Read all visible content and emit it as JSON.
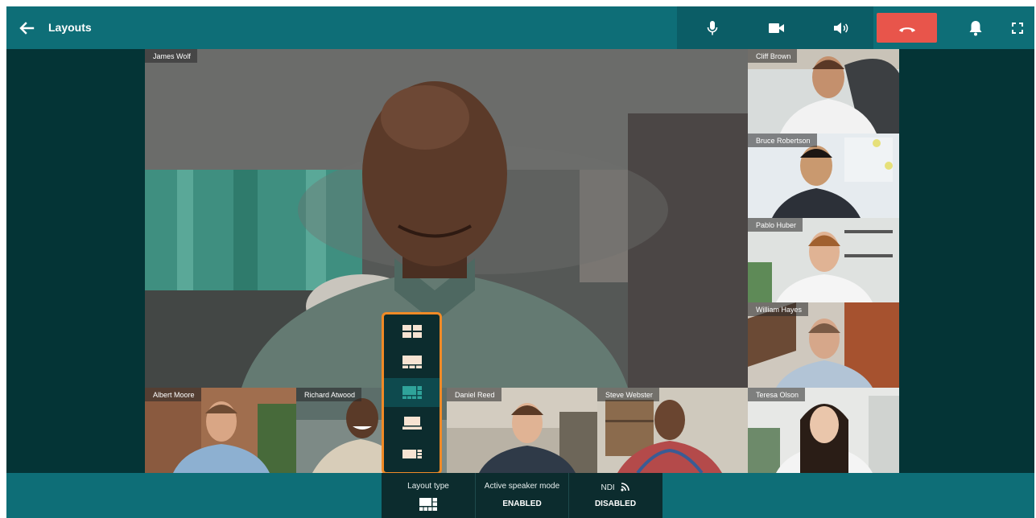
{
  "header": {
    "title": "Layouts",
    "icons": [
      "back-arrow-icon",
      "microphone-icon",
      "camera-icon",
      "speaker-icon",
      "hang-up-icon",
      "bell-icon",
      "fullscreen-icon"
    ]
  },
  "participants": {
    "main": "James Wolf",
    "side": [
      "Cliff Brown",
      "Bruce Robertson",
      "Pablo Huber",
      "William Hayes"
    ],
    "bottom": [
      "Albert Moore",
      "Richard Atwood",
      "Daniel Reed",
      "Steve Webster",
      "Teresa Olson"
    ]
  },
  "layout_picker": {
    "options": [
      "grid-layout-icon",
      "speaker-top-layout-icon",
      "mosaic-layout-icon",
      "speaker-bottom-layout-icon",
      "speaker-side-layout-icon"
    ],
    "selected_index": 2
  },
  "bottom_bar": {
    "layout_type": {
      "label": "Layout type",
      "icon": "mosaic-layout-icon"
    },
    "active_speaker": {
      "label": "Active speaker mode",
      "value": "ENABLED"
    },
    "ndi": {
      "label": "NDI",
      "icon": "broadcast-icon",
      "value": "DISABLED"
    }
  },
  "colors": {
    "topbar": "#0e6e77",
    "background": "#043436",
    "hangup": "#e8554b",
    "picker_border": "#f08a26",
    "active_layout": "#2fa39a"
  }
}
